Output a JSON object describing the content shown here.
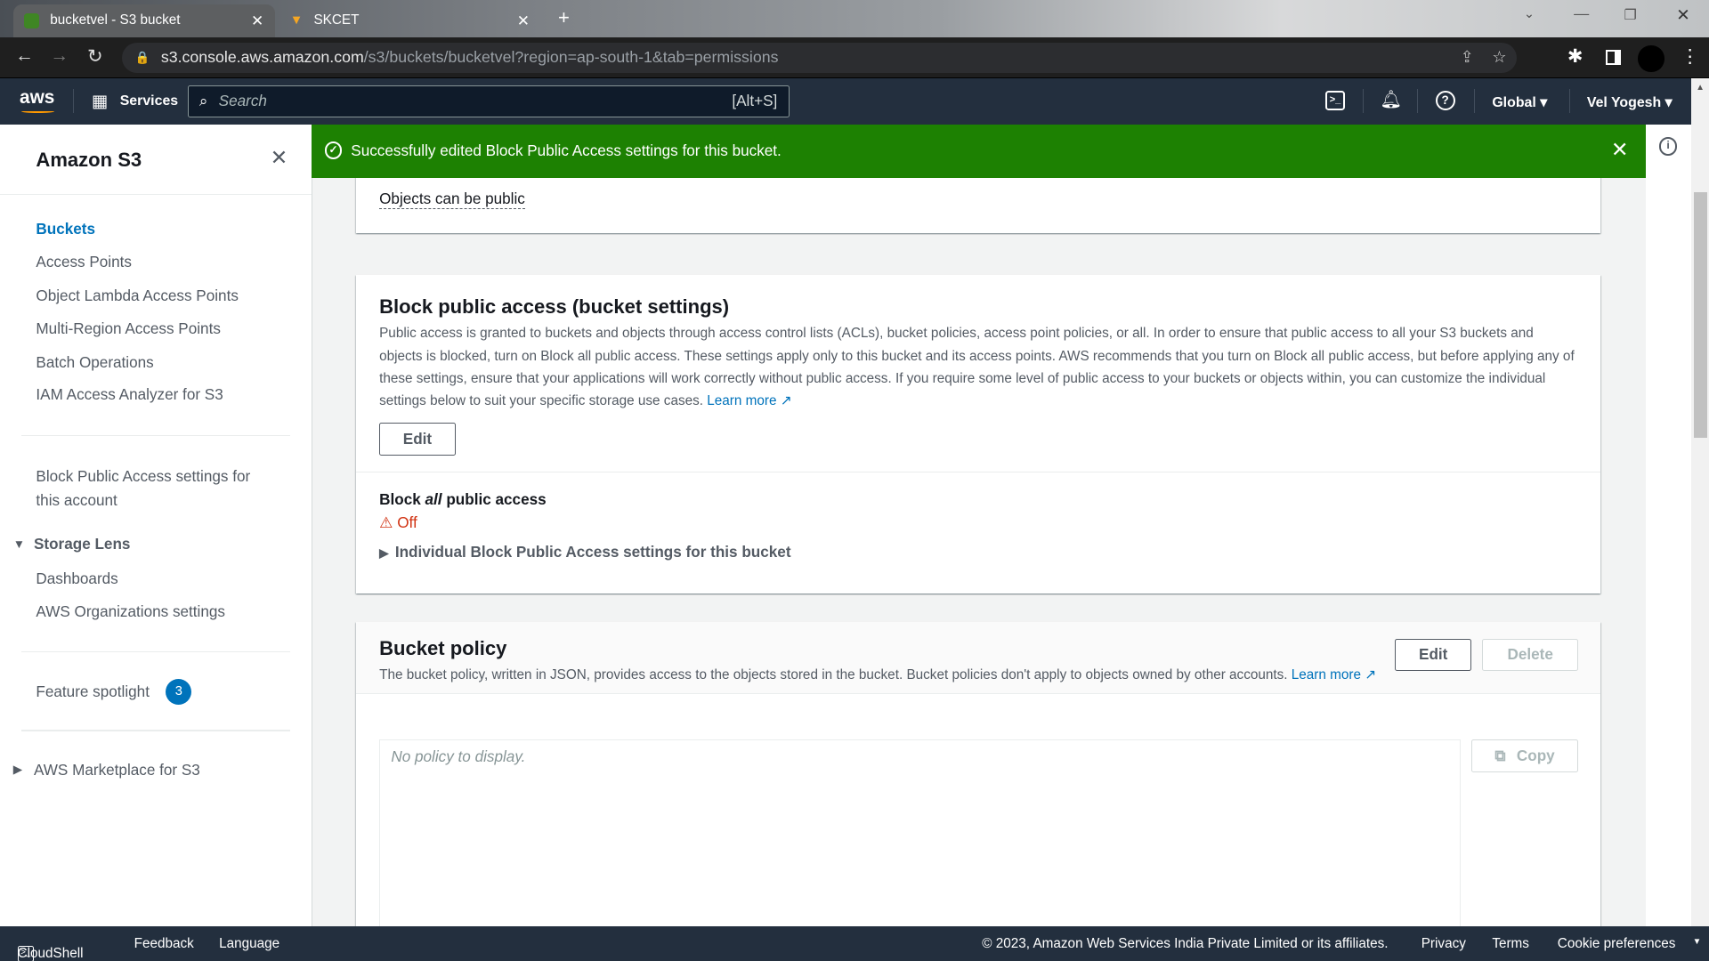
{
  "browser": {
    "tabs": [
      {
        "title": "bucketvel - S3 bucket",
        "active": true
      },
      {
        "title": "SKCET",
        "active": false
      }
    ],
    "url_host": "s3.console.aws.amazon.com",
    "url_path": "/s3/buckets/bucketvel?region=ap-south-1&tab=permissions"
  },
  "aws_nav": {
    "logo": "aws",
    "services": "Services",
    "search_placeholder": "Search",
    "search_shortcut": "[Alt+S]",
    "region": "Global",
    "user": "Vel Yogesh"
  },
  "sidebar": {
    "title": "Amazon S3",
    "items": [
      "Buckets",
      "Access Points",
      "Object Lambda Access Points",
      "Multi-Region Access Points",
      "Batch Operations",
      "IAM Access Analyzer for S3"
    ],
    "account_setting": "Block Public Access settings for this account",
    "storage_lens": {
      "label": "Storage Lens",
      "items": [
        "Dashboards",
        "AWS Organizations settings"
      ]
    },
    "feature_spotlight": "Feature spotlight",
    "feature_spotlight_count": "3",
    "marketplace": "AWS Marketplace for S3"
  },
  "flash": {
    "message": "Successfully edited Block Public Access settings for this bucket.",
    "color": "#1d8102"
  },
  "access_card": {
    "value": "Objects can be public"
  },
  "bpa": {
    "title": "Block public access (bucket settings)",
    "description": "Public access is granted to buckets and objects through access control lists (ACLs), bucket policies, access point policies, or all. In order to ensure that public access to all your S3 buckets and objects is blocked, turn on Block all public access. These settings apply only to this bucket and its access points. AWS recommends that you turn on Block all public access, but before applying any of these settings, ensure that your applications will work correctly without public access. If you require some level of public access to your buckets or objects within, you can customize the individual settings below to suit your specific storage use cases.",
    "learn_more": "Learn more",
    "edit": "Edit",
    "block_all_pre": "Block ",
    "block_all_em": "all",
    "block_all_post": " public access",
    "status": "Off",
    "status_color": "#d13212",
    "individual": "Individual Block Public Access settings for this bucket"
  },
  "policy": {
    "title": "Bucket policy",
    "description": "The bucket policy, written in JSON, provides access to the objects stored in the bucket. Bucket policies don't apply to objects owned by other accounts.",
    "learn_more": "Learn more",
    "edit": "Edit",
    "delete": "Delete",
    "empty": "No policy to display.",
    "copy": "Copy"
  },
  "footer": {
    "cloudshell": "CloudShell",
    "feedback": "Feedback",
    "language": "Language",
    "copyright": "© 2023, Amazon Web Services India Private Limited or its affiliates.",
    "privacy": "Privacy",
    "terms": "Terms",
    "cookies": "Cookie preferences"
  }
}
